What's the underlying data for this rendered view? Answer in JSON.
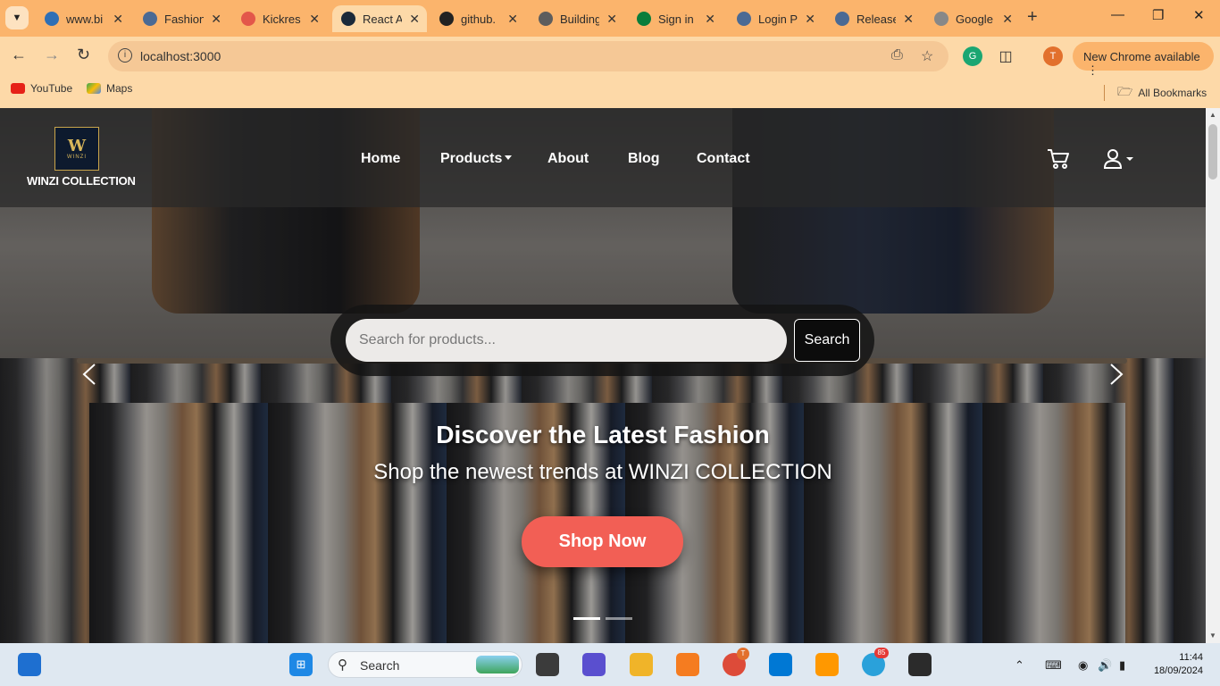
{
  "browser": {
    "tabs": [
      {
        "title": "www.bi",
        "color": "#2f6fb5",
        "active": false
      },
      {
        "title": "Fashion",
        "color": "#4b6a94",
        "active": false
      },
      {
        "title": "Kickres",
        "color": "#e3574a",
        "active": false
      },
      {
        "title": "React A",
        "color": "#1b2a3a",
        "active": true
      },
      {
        "title": "github.",
        "color": "#222222",
        "active": false
      },
      {
        "title": "Building",
        "color": "#5d5d5d",
        "active": false
      },
      {
        "title": "Sign in",
        "color": "#0a7d3b",
        "active": false
      },
      {
        "title": "Login P",
        "color": "#4b6a94",
        "active": false
      },
      {
        "title": "Release",
        "color": "#4b6a94",
        "active": false
      },
      {
        "title": "Google",
        "color": "#888888",
        "active": false
      }
    ],
    "url": "localhost:3000",
    "profile_initial": "T",
    "update_label": "New Chrome available",
    "bookmarks": [
      "YouTube",
      "Maps"
    ],
    "all_bookmarks_label": "All Bookmarks"
  },
  "site": {
    "brand": "WINZI COLLECTION",
    "logo_letters": "W",
    "logo_small": "WINZI",
    "nav": {
      "home": "Home",
      "products": "Products",
      "about": "About",
      "blog": "Blog",
      "contact": "Contact"
    },
    "search": {
      "placeholder": "Search for products...",
      "button": "Search"
    },
    "hero": {
      "title": "Discover the Latest Fashion",
      "subtitle": "Shop the newest trends at WINZI COLLECTION",
      "cta": "Shop Now"
    },
    "carousel": {
      "slides": 2,
      "active_index": 0
    }
  },
  "taskbar": {
    "search_label": "Search",
    "time": "11:44",
    "date": "18/09/2024",
    "telegram_badge": "85",
    "chrome_badge": "T"
  },
  "colors": {
    "tab_bar": "#fbb46c",
    "toolbar": "#fdd9a8",
    "cta": "#f25f55",
    "taskbar": "#dfe8f1"
  }
}
